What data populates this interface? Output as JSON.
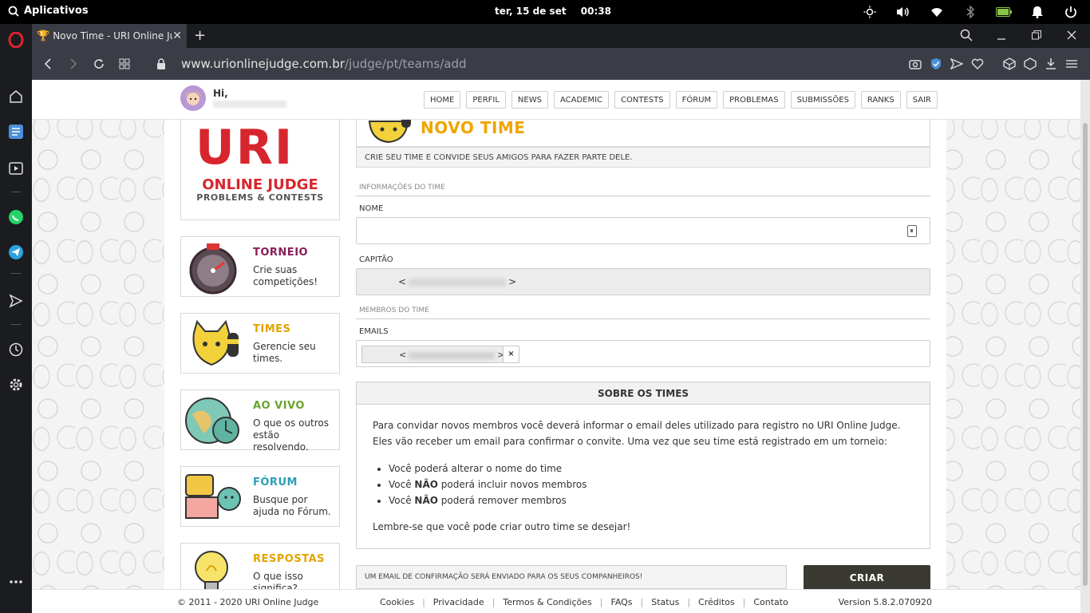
{
  "os": {
    "activities": "Aplicativos",
    "date": "ter, 15 de set",
    "time": "00:38"
  },
  "browser": {
    "tab_title": "Novo Time - URI Online Judge",
    "url_host": "www.urionlinejudge.com.br",
    "url_path": "/judge/pt/teams/add"
  },
  "header": {
    "greeting": "Hi,",
    "menu": [
      "HOME",
      "PERFIL",
      "NEWS",
      "ACADEMIC",
      "CONTESTS",
      "FÓRUM",
      "PROBLEMAS",
      "SUBMISSÕES",
      "RANKS",
      "SAIR"
    ]
  },
  "brand": {
    "logo": "URI",
    "name": "ONLINE JUDGE",
    "tagline": "PROBLEMS & CONTESTS"
  },
  "cards": [
    {
      "title": "TORNEIO",
      "desc": "Crie suas competições!",
      "color": "#8b1c5a"
    },
    {
      "title": "TIMES",
      "desc": "Gerencie seu times.",
      "color": "#e2a400"
    },
    {
      "title": "AO VIVO",
      "desc": "O que os outros estão resolvendo.",
      "color": "#6aa52f"
    },
    {
      "title": "FÓRUM",
      "desc": "Busque por ajuda no Fórum.",
      "color": "#2a9fb3"
    },
    {
      "title": "RESPOSTAS",
      "desc": "O que isso significa?",
      "color": "#e2a400"
    }
  ],
  "page": {
    "title": "NOVO TIME",
    "subtitle": "CRIE SEU TIME E CONVIDE SEUS AMIGOS PARA FAZER PARTE DELE."
  },
  "form": {
    "section_info": "INFORMAÇÕES DO TIME",
    "name_label": "NOME",
    "name_value": "",
    "captain_label": "CAPITÃO",
    "section_members": "MEMBROS DO TIME",
    "emails_label": "EMAILS",
    "remove_tag": "×"
  },
  "about": {
    "heading": "SOBRE OS TIMES",
    "intro": "Para convidar novos membros você deverá informar o email deles utilizado para registro no URI Online Judge. Eles vão receber um email para confirmar o convite. Uma vez que seu time está registrado em um torneio:",
    "item1": "Você poderá alterar o nome do time",
    "item2_pre": "Você ",
    "item2_bold": "NÃO",
    "item2_post": " poderá incluir novos membros",
    "item3_pre": "Você ",
    "item3_bold": "NÃO",
    "item3_post": " poderá remover membros",
    "outro": "Lembre-se que você pode criar outro time se desejar!"
  },
  "notice": "UM EMAIL DE CONFIRMAÇÃO SERÁ ENVIADO PARA OS SEUS COMPANHEIROS!",
  "submit_label": "CRIAR",
  "footer": {
    "copyright": "© 2011 - 2020 URI Online Judge",
    "links": [
      "Cookies",
      "Privacidade",
      "Termos & Condições",
      "FAQs",
      "Status",
      "Créditos",
      "Contato"
    ],
    "version": "Version 5.8.2.070920"
  }
}
